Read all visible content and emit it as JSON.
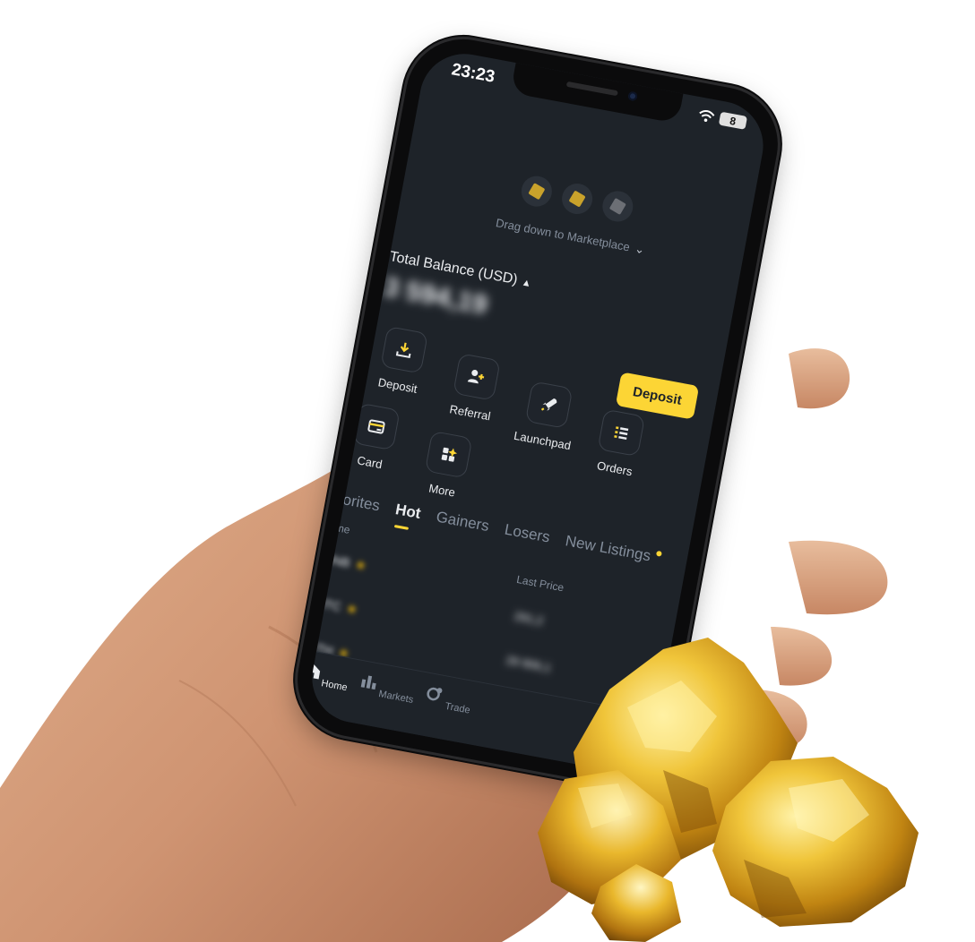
{
  "status_bar": {
    "time": "23:23",
    "battery": "8"
  },
  "marketplace": {
    "hint": "Drag down to Marketplace"
  },
  "balance": {
    "label": "Total Balance (USD)",
    "value": "3 594,19"
  },
  "deposit_button": "Deposit",
  "quick_actions": [
    {
      "label": "Deposit",
      "icon": "download-icon"
    },
    {
      "label": "Referral",
      "icon": "add-user-icon"
    },
    {
      "label": "Launchpad",
      "icon": "rocket-icon"
    },
    {
      "label": "Orders",
      "icon": "list-icon"
    },
    {
      "label": "Card",
      "icon": "card-icon"
    },
    {
      "label": "More",
      "icon": "grid-icon"
    }
  ],
  "market_tabs": [
    "Favorites",
    "Hot",
    "Gainers",
    "Losers",
    "New Listings"
  ],
  "active_tab": "Hot",
  "table": {
    "col_name": "Name",
    "col_last_price": "Last Price"
  },
  "bottom_nav": [
    "Home",
    "Markets",
    "Trade"
  ],
  "colors": {
    "accent": "#fcd535",
    "screen_bg": "#1e2329",
    "muted_text": "#848e9c"
  }
}
